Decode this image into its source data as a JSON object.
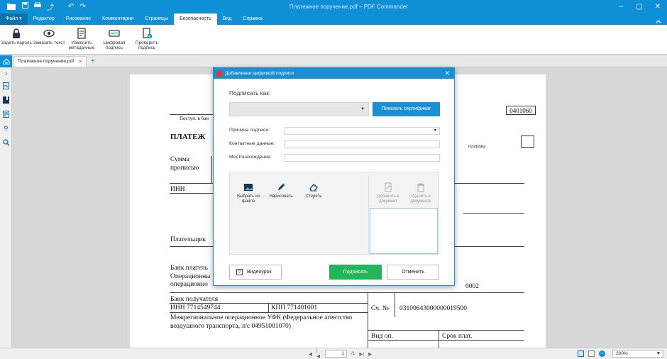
{
  "window": {
    "title": "Платежное поручение.pdf – PDF Commander"
  },
  "menu": [
    "Файл",
    "Редактор",
    "Рисование",
    "Комментарии",
    "Страницы",
    "Безопасность",
    "Вид",
    "Справка"
  ],
  "ribbon": {
    "btn1": "Задать пароль",
    "btn2": "Замазать текст",
    "btn3": "Изменить метаданные",
    "btn4": "Цифровая подпись",
    "btn5": "Проверить подпись"
  },
  "tab": {
    "name": "Платежное поручение.pdf"
  },
  "doc": {
    "okud": "0401060",
    "postup": "Поступ. в бан",
    "title": "ПЛАТЕЖ",
    "platezha": "платежа",
    "summa": "Сумма",
    "propisyu": "прописью",
    "inn": "ИНН",
    "payer": "Плательщик",
    "bank_payer": "Банк платель",
    "oper1": "Операционны",
    "oper2": "операционно",
    "acct_partial": "0002",
    "bank_recv": "Банк получателя",
    "inn_recv": "ИНН 7714549744",
    "kpp": "КПП 771401001",
    "sch": "Сч. №",
    "account": "03100643000000019500",
    "recv1": "Межрегиональное операционное УФК (Федеральное агентство",
    "recv2": "воздушного транспорта, л/с 04951001070)",
    "vid_op": "Вид оп.",
    "srok": "Срок плат."
  },
  "dialog": {
    "title": "Добавление цифровой подписи",
    "sign_as": "Подписать как:",
    "show_cert": "Показать сертификат",
    "reason_label": "Причина подписи:",
    "contact_label": "Контактные данные:",
    "location_label": "Местонахождение:",
    "tool_file": "Выбрать из файла",
    "tool_draw": "Нарисовать",
    "tool_erase": "Стереть",
    "tool_add": "Добавить в документ",
    "tool_delete": "Удалить в документе",
    "video": "Видеоурок",
    "sign": "Подписать",
    "cancel": "Отменить"
  },
  "status": {
    "page": "1",
    "total": "/1",
    "zoom": "200%"
  }
}
